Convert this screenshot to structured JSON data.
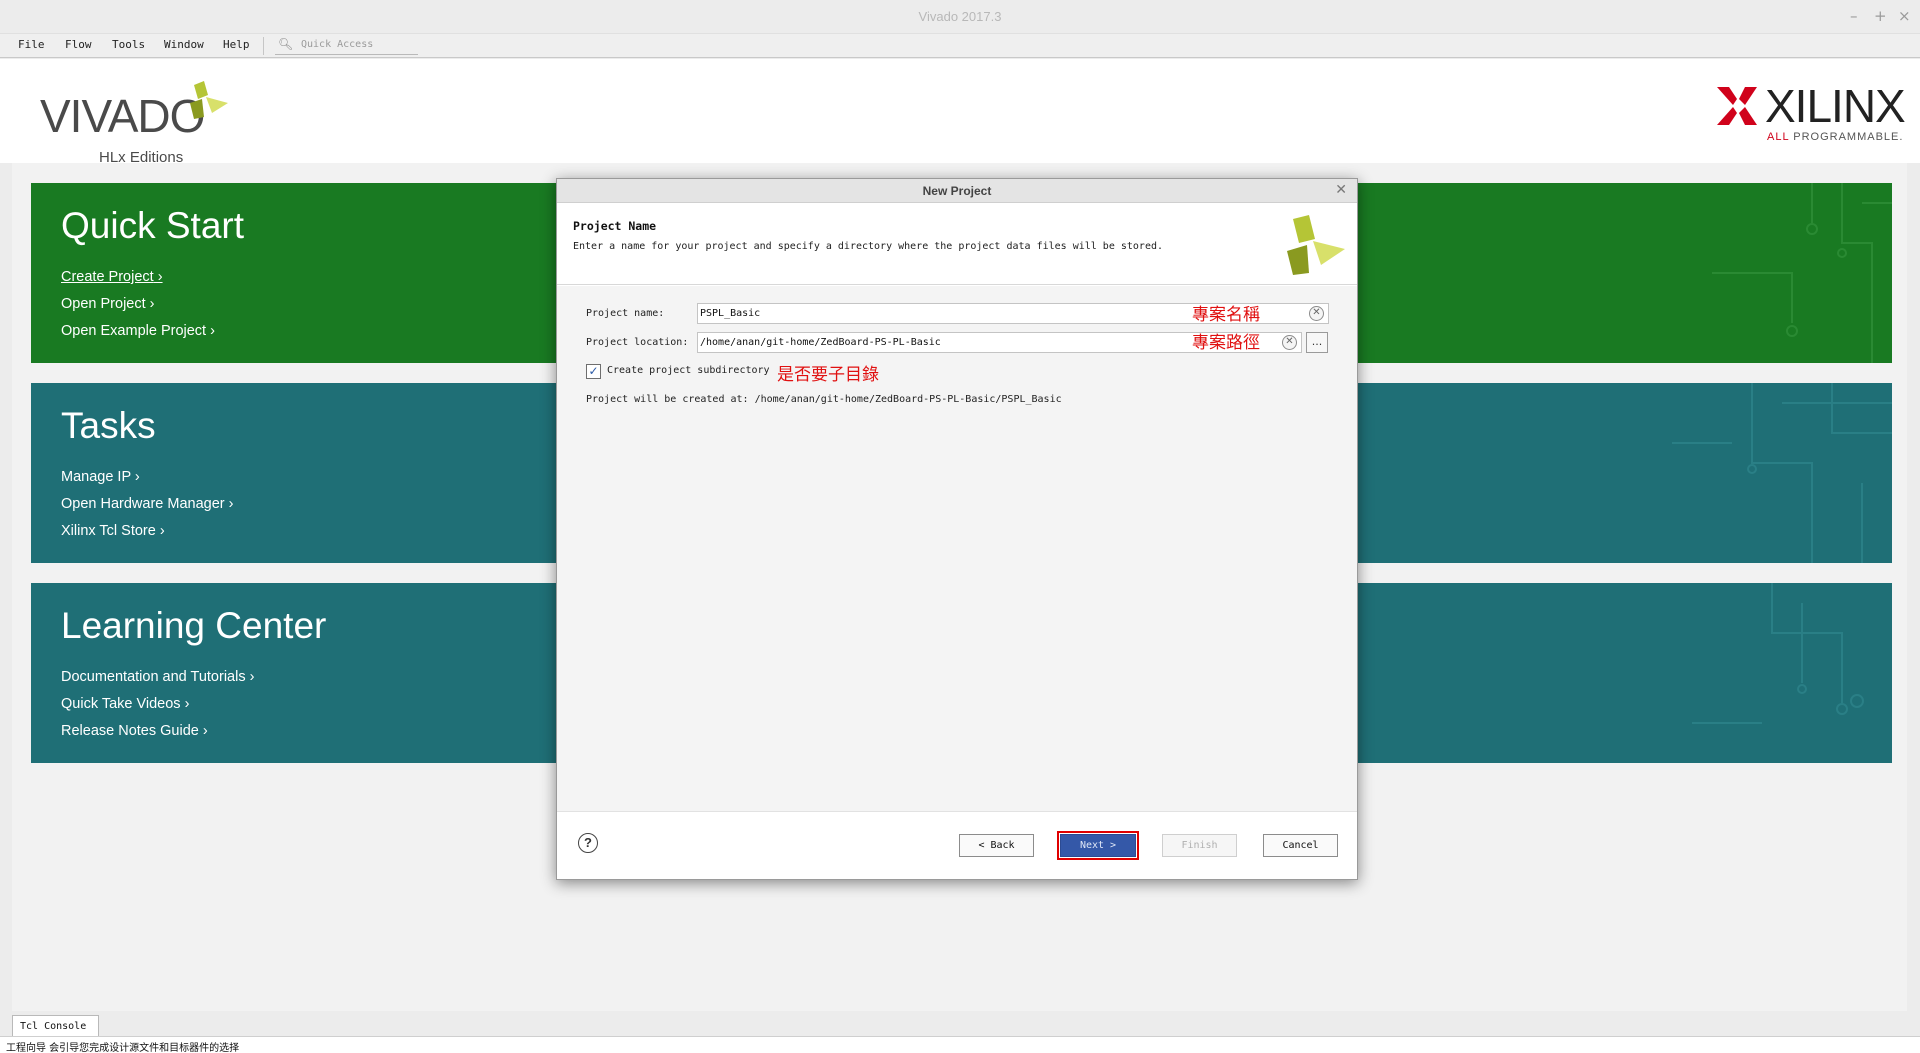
{
  "window": {
    "title": "Vivado 2017.3",
    "controls": [
      "–",
      "+",
      "×"
    ]
  },
  "menubar": {
    "items": [
      "File",
      "Flow",
      "Tools",
      "Window",
      "Help"
    ],
    "quick_access_placeholder": "Quick Access"
  },
  "header": {
    "vivado_logo": "VIVADO",
    "vivado_subtitle": "HLx Editions",
    "xilinx_logo": "XILINX",
    "xilinx_tagline_prefix": "ALL ",
    "xilinx_tagline": "PROGRAMMABLE."
  },
  "quick_start": {
    "title": "Quick Start",
    "links": [
      "Create Project",
      "Open Project",
      "Open Example Project"
    ]
  },
  "tasks": {
    "title": "Tasks",
    "links": [
      "Manage IP",
      "Open Hardware Manager",
      "Xilinx Tcl Store"
    ]
  },
  "learning_center": {
    "title": "Learning Center",
    "links": [
      "Documentation and Tutorials",
      "Quick Take Videos",
      "Release Notes Guide"
    ]
  },
  "dialog": {
    "title": "New Project",
    "heading": "Project Name",
    "description": "Enter a name for your project and specify a directory where the project data files will be stored.",
    "project_name_label": "Project name:",
    "project_name_value": "PSPL_Basic",
    "project_location_label": "Project location:",
    "project_location_value": "/home/anan/git-home/ZedBoard-PS-PL-Basic",
    "browse_label": "...",
    "subdirectory_label": "Create project subdirectory",
    "subdirectory_checked": true,
    "created_at_text": "Project will be created at: /home/anan/git-home/ZedBoard-PS-PL-Basic/PSPL_Basic",
    "annotations": {
      "name": "專案名稱",
      "location": "專案路徑",
      "subdirectory": "是否要子目錄"
    },
    "buttons": {
      "help": "?",
      "back": "< Back",
      "next": "Next >",
      "finish": "Finish",
      "cancel": "Cancel"
    }
  },
  "bottom": {
    "tcl_console_tab": "Tcl Console",
    "status_text": "工程向导 会引导您完成设计源文件和目标器件的选择"
  },
  "colors": {
    "quick_start_bg": "#197a22",
    "tasks_bg": "#1f6f76",
    "primary_button": "#3458a8",
    "annotation": "#e01010"
  }
}
